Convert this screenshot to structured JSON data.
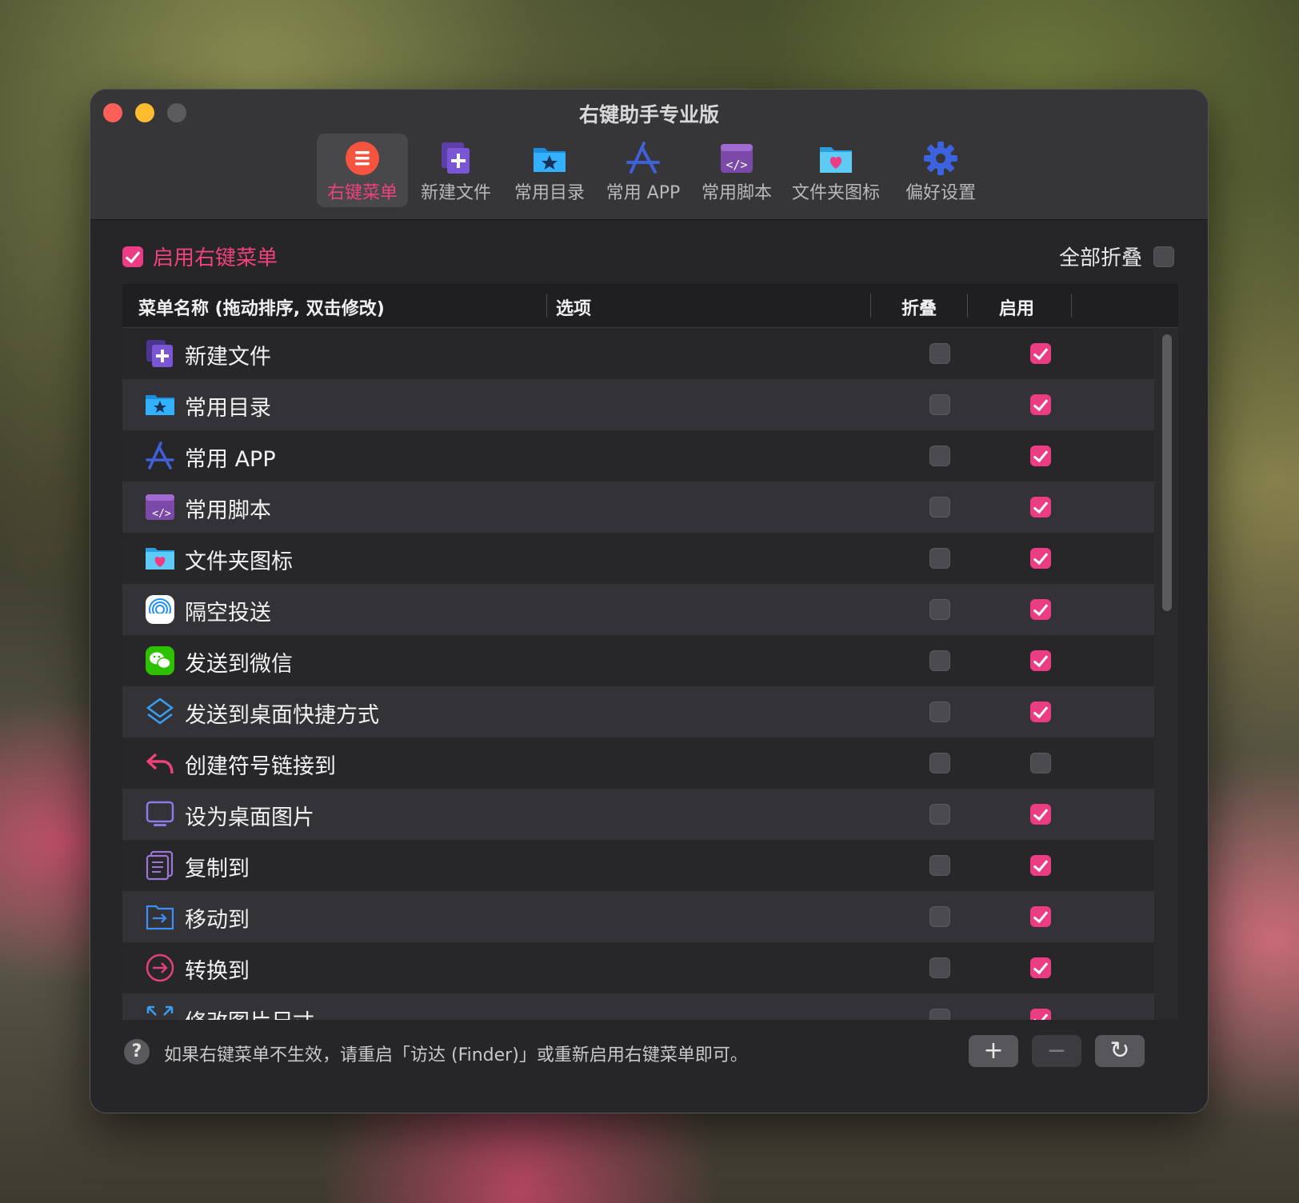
{
  "window": {
    "title": "右键助手专业版"
  },
  "tabs": [
    {
      "label": "右键菜单",
      "icon": "context-menu-icon",
      "active": true
    },
    {
      "label": "新建文件",
      "icon": "new-file-icon"
    },
    {
      "label": "常用目录",
      "icon": "folder-star-icon"
    },
    {
      "label": "常用 APP",
      "icon": "app-store-icon"
    },
    {
      "label": "常用脚本",
      "icon": "script-icon"
    },
    {
      "label": "文件夹图标",
      "icon": "folder-heart-icon"
    },
    {
      "label": "偏好设置",
      "icon": "gear-icon"
    }
  ],
  "enable_menu": {
    "label": "启用右键菜单",
    "checked": true
  },
  "collapse_all": {
    "label": "全部折叠",
    "checked": false
  },
  "table": {
    "headers": {
      "name": "菜单名称 (拖动排序, 双击修改)",
      "options": "选项",
      "fold": "折叠",
      "enable": "启用"
    },
    "rows": [
      {
        "label": "新建文件",
        "icon": "new-file-icon",
        "fold": false,
        "enabled": true
      },
      {
        "label": "常用目录",
        "icon": "folder-star-icon",
        "fold": false,
        "enabled": true
      },
      {
        "label": "常用 APP",
        "icon": "app-store-icon",
        "fold": false,
        "enabled": true
      },
      {
        "label": "常用脚本",
        "icon": "script-icon",
        "fold": false,
        "enabled": true
      },
      {
        "label": "文件夹图标",
        "icon": "folder-heart-icon",
        "fold": false,
        "enabled": true
      },
      {
        "label": "隔空投送",
        "icon": "airdrop-icon",
        "fold": false,
        "enabled": true
      },
      {
        "label": "发送到微信",
        "icon": "wechat-icon",
        "fold": false,
        "enabled": true
      },
      {
        "label": "发送到桌面快捷方式",
        "icon": "shortcut-icon",
        "fold": false,
        "enabled": true
      },
      {
        "label": "创建符号链接到",
        "icon": "reply-arrow-icon",
        "fold": false,
        "enabled": false
      },
      {
        "label": "设为桌面图片",
        "icon": "monitor-icon",
        "fold": false,
        "enabled": true
      },
      {
        "label": "复制到",
        "icon": "copy-icon",
        "fold": false,
        "enabled": true
      },
      {
        "label": "移动到",
        "icon": "move-icon",
        "fold": false,
        "enabled": true
      },
      {
        "label": "转换到",
        "icon": "convert-icon",
        "fold": false,
        "enabled": true
      },
      {
        "label": "修改图片尺寸",
        "icon": "resize-icon",
        "fold": false,
        "enabled": true
      }
    ]
  },
  "footer": {
    "help": "?",
    "hint": "如果右键菜单不生效，请重启「访达 (Finder)」或重新启用右键菜单即可。",
    "add": "+",
    "remove": "−",
    "refresh": "↻"
  },
  "colors": {
    "accent": "#ec3d84",
    "window_bg": "#262528",
    "titlebar_bg": "#363538"
  }
}
